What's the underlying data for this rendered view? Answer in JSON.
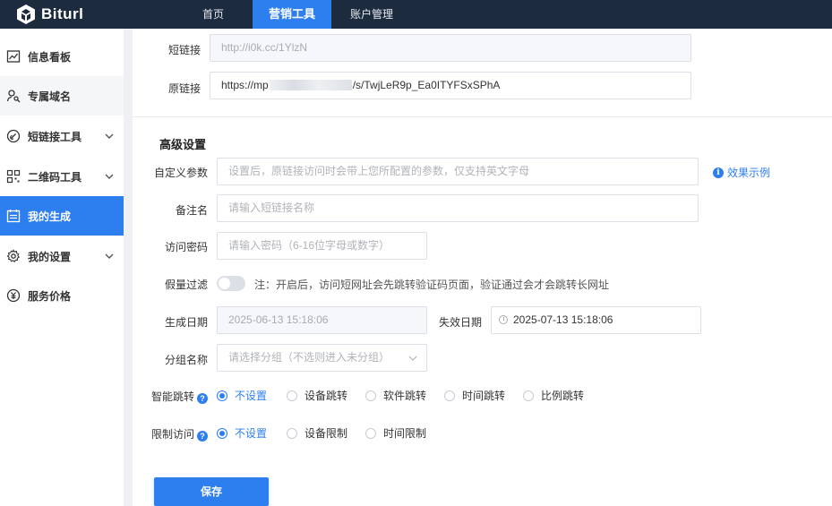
{
  "brand": {
    "name": "Biturl",
    "accent": "#2d7ff0",
    "topbar_bg": "#1d2b3f"
  },
  "nav": [
    {
      "label": "首页",
      "active": false
    },
    {
      "label": "营销工具",
      "active": true
    },
    {
      "label": "账户管理",
      "active": false
    }
  ],
  "sidebar": {
    "items": [
      {
        "label": "信息看板",
        "icon": "chart-icon",
        "expandable": false,
        "active": false
      },
      {
        "label": "专属域名",
        "icon": "user-key-icon",
        "expandable": false,
        "active": false
      },
      {
        "label": "短链接工具",
        "icon": "link-icon",
        "expandable": true,
        "active": false
      },
      {
        "label": "二维码工具",
        "icon": "qrcode-icon",
        "expandable": true,
        "active": false
      },
      {
        "label": "我的生成",
        "icon": "calendar-list-icon",
        "expandable": false,
        "active": true
      },
      {
        "label": "我的设置",
        "icon": "gear-icon",
        "expandable": true,
        "active": false
      },
      {
        "label": "服务价格",
        "icon": "yen-icon",
        "expandable": false,
        "active": false
      }
    ]
  },
  "form": {
    "short_link": {
      "label": "短链接",
      "value": "http://i0k.cc/1YlzN"
    },
    "original_link": {
      "label": "原链接",
      "value_prefix": "https://mp",
      "value_suffix": "/s/TwjLeR9p_Ea0ITYFSxSPhA"
    },
    "advanced_title": "高级设置",
    "custom_params": {
      "label": "自定义参数",
      "placeholder": "设置后，原链接访问时会带上您所配置的参数，仅支持英文字母"
    },
    "example_link": "效果示例",
    "remark": {
      "label": "备注名",
      "placeholder": "请输入短链接名称"
    },
    "password": {
      "label": "访问密码",
      "placeholder": "请输入密码（6-16位字母或数字）"
    },
    "fake_filter": {
      "label": "假量过滤",
      "enabled": false,
      "note": "注：开启后，访问短网址会先跳转验证码页面，验证通过会才会跳转长网址"
    },
    "created_date": {
      "label": "生成日期",
      "value": "2025-06-13 15:18:06"
    },
    "expire_date": {
      "label": "失效日期",
      "value": "2025-07-13 15:18:06"
    },
    "group": {
      "label": "分组名称",
      "placeholder": "请选择分组（不选则进入未分组）"
    },
    "smart_jump": {
      "label": "智能跳转",
      "options": [
        "不设置",
        "设备跳转",
        "软件跳转",
        "时间跳转",
        "比例跳转"
      ],
      "selected": "不设置"
    },
    "limit_access": {
      "label": "限制访问",
      "options": [
        "不设置",
        "设备限制",
        "时间限制"
      ],
      "selected": "不设置"
    },
    "save_label": "保存"
  }
}
